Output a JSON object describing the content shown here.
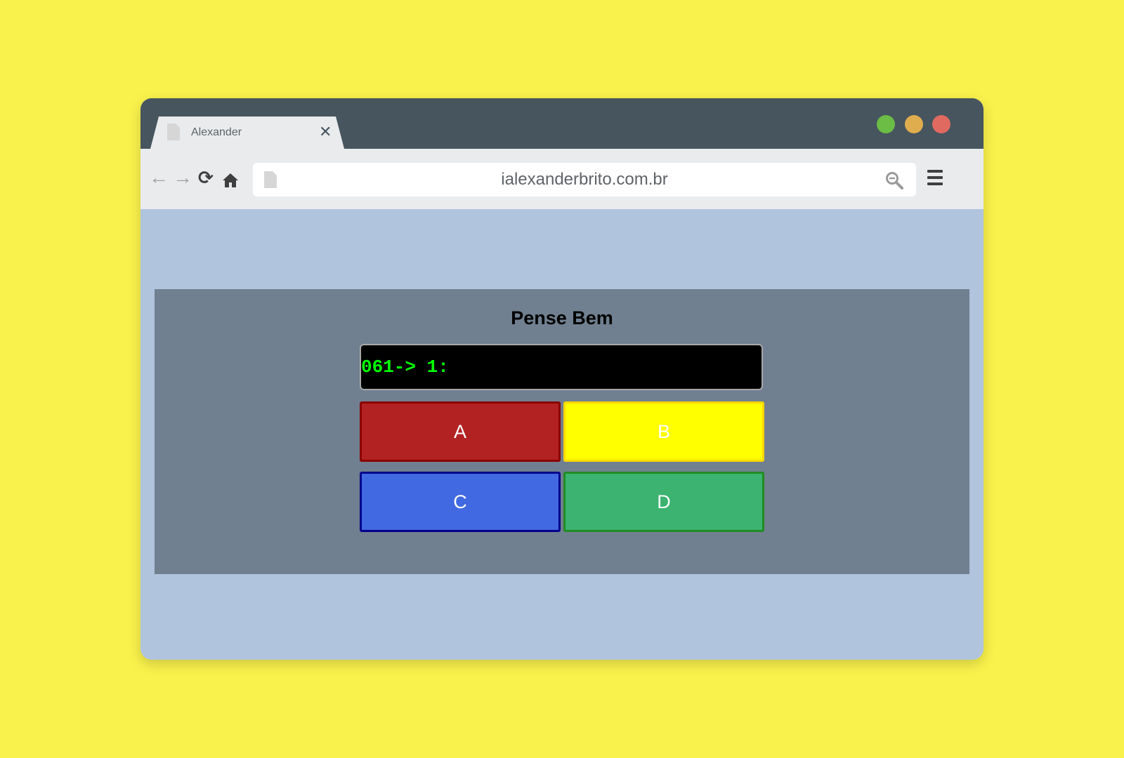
{
  "browser": {
    "tab": {
      "title": "Alexander",
      "icon": "document-icon",
      "close_label": "✕"
    },
    "window_controls": [
      {
        "name": "maximize",
        "color": "#6bbd45"
      },
      {
        "name": "minimize",
        "color": "#e0ad4e"
      },
      {
        "name": "close",
        "color": "#e06a60"
      }
    ],
    "toolbar": {
      "back_icon": "←",
      "forward_icon": "→",
      "reload_icon": "⟳",
      "home_icon": "home-icon",
      "url": "ialexanderbrito.com.br",
      "search_icon": "search-icon",
      "menu_icon": "hamburger-menu-icon"
    }
  },
  "page": {
    "background_color": "#b0c4de",
    "panel_color": "#708090",
    "title": "Pense Bem",
    "display": {
      "text": "061-> 1:",
      "text_color": "#00ff00",
      "background_color": "#000000"
    },
    "buttons": [
      {
        "label": "A",
        "color": "#b22222",
        "border": "#8b0000"
      },
      {
        "label": "B",
        "color": "#ffff00",
        "border": "#ffd700"
      },
      {
        "label": "C",
        "color": "#4169e1",
        "border": "#00008b"
      },
      {
        "label": "D",
        "color": "#3cb371",
        "border": "#228b22"
      }
    ]
  },
  "colors": {
    "desktop_background": "#f9f24c",
    "titlebar": "#47555e",
    "toolbar": "#e9ebed"
  }
}
